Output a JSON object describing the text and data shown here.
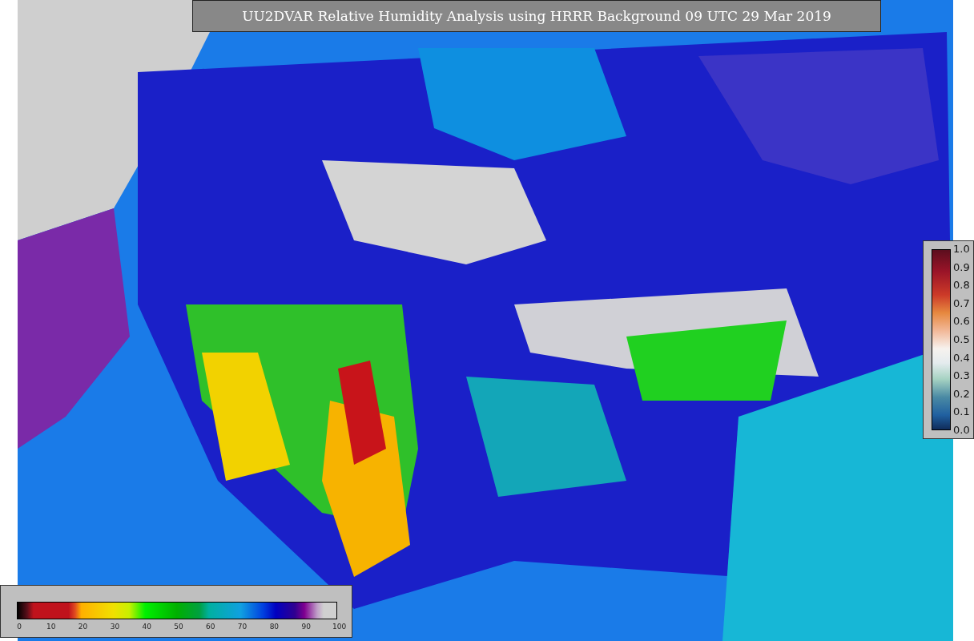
{
  "title": "UU2DVAR Relative Humidity Analysis using HRRR Background 09 UTC 29 Mar 2019",
  "observation_colorbar": {
    "ticks": [
      "1.0",
      "0.9",
      "0.8",
      "0.7",
      "0.6",
      "0.5",
      "0.4",
      "0.3",
      "0.2",
      "0.1",
      "0.0"
    ]
  },
  "humidity_colorbar": {
    "ticks": [
      "0",
      "10",
      "20",
      "30",
      "40",
      "50",
      "60",
      "70",
      "80",
      "90",
      "100"
    ]
  }
}
